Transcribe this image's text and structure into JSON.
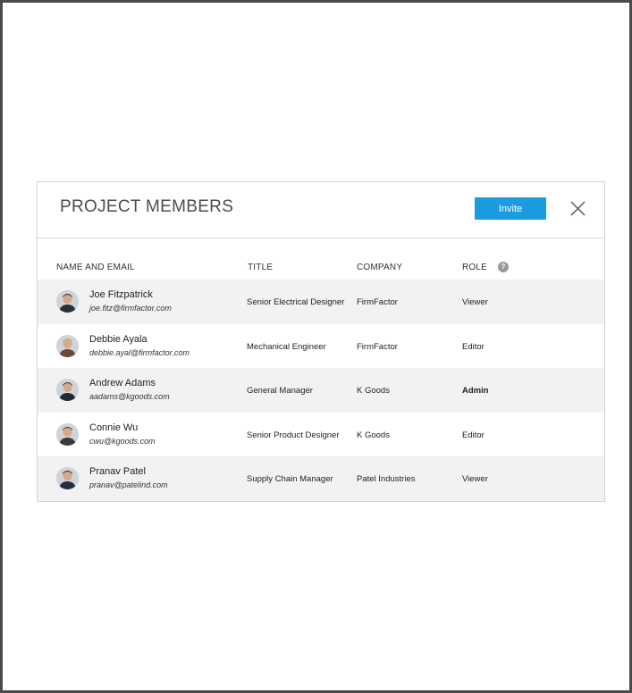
{
  "modal": {
    "title": "PROJECT MEMBERS",
    "invite_label": "Invite"
  },
  "columns": {
    "name_email": "NAME AND EMAIL",
    "title": "TITLE",
    "company": "COMPANY",
    "role": "ROLE",
    "role_help": "?"
  },
  "icons": {
    "close": "close-icon",
    "help": "help-icon",
    "avatar": "avatar"
  },
  "colors": {
    "accent": "#1c9ce0",
    "row_shade": "#f2f2f2"
  },
  "members": [
    {
      "name": "Joe Fitzpatrick",
      "email": "joe.fitz@firmfactor.com",
      "title": "Senior Electrical Designer",
      "company": "FirmFactor",
      "role": "Viewer"
    },
    {
      "name": "Debbie Ayala",
      "email": "debbie.ayal@firmfactor.com",
      "title": "Mechanical Engineer",
      "company": "FirmFactor",
      "role": "Editor"
    },
    {
      "name": "Andrew Adams",
      "email": "aadams@kgoods.com",
      "title": "General Manager",
      "company": "K Goods",
      "role": "Admin"
    },
    {
      "name": "Connie Wu",
      "email": "cwu@kgoods.com",
      "title": "Senior Product Designer",
      "company": "K Goods",
      "role": "Editor"
    },
    {
      "name": "Pranav Patel",
      "email": "pranav@patelind.com",
      "title": "Supply Chain Manager",
      "company": "Patel Industries",
      "role": "Viewer"
    }
  ]
}
